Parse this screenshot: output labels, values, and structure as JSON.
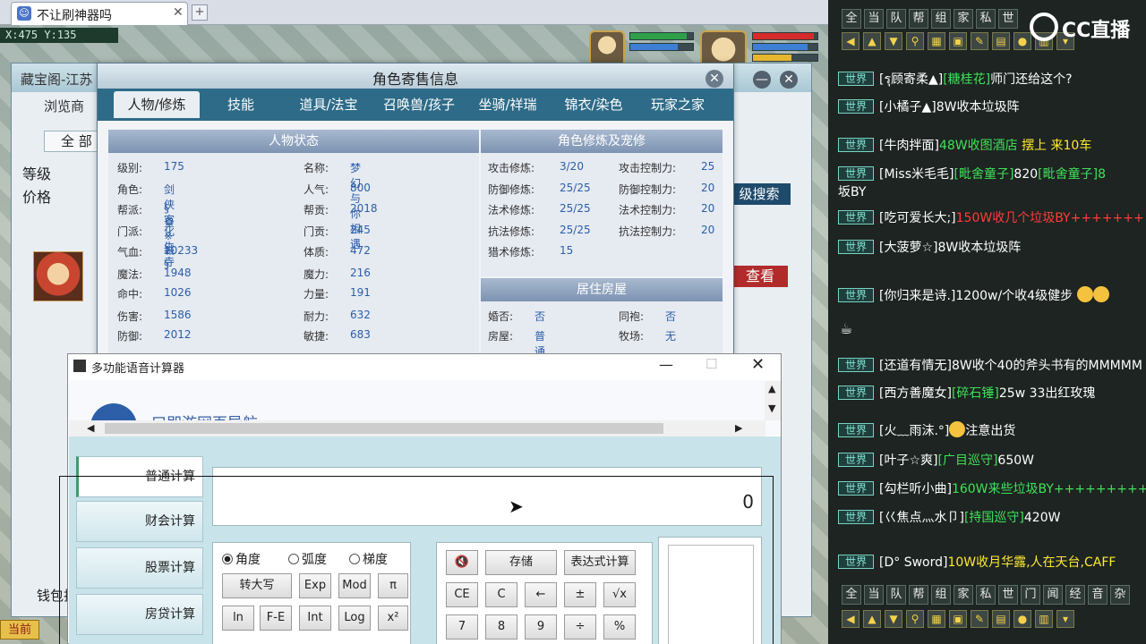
{
  "browser": {
    "tab_title": "不让刷神器吗",
    "tab_close": "✕",
    "tab_add": "+"
  },
  "game": {
    "coords": "X:475 Y:135",
    "bottom_badge": "当前"
  },
  "treasure": {
    "title": "藏宝阁-江苏",
    "browse": "浏览商",
    "all": "全 部",
    "level_label": "等级",
    "price_label": "价格",
    "adv_search": "级搜索",
    "view": "查看",
    "wallet": "钱包抄"
  },
  "role": {
    "title": "角色寄售信息",
    "tabs": [
      "人物/修炼",
      "技能",
      "道具/法宝",
      "召唤兽/孩子",
      "坐骑/祥瑞",
      "锦衣/染色",
      "玩家之家"
    ],
    "status_head": "人物状态",
    "cultivation_head": "角色修炼及宠修",
    "house_head": "居住房屋",
    "left_col": [
      {
        "k": "级别:",
        "v": "175"
      },
      {
        "k": "角色:",
        "v": "剑侠客"
      },
      {
        "k": "帮派:",
        "v": "§皇※城§"
      },
      {
        "k": "门派:",
        "v": "化生寺"
      },
      {
        "k": "气血:",
        "v": "10233"
      },
      {
        "k": "魔法:",
        "v": "1948"
      },
      {
        "k": "命中:",
        "v": "1026"
      },
      {
        "k": "伤害:",
        "v": "1586"
      },
      {
        "k": "防御:",
        "v": "2012"
      }
    ],
    "mid_col": [
      {
        "k": "名称:",
        "v": "梦幻与你相遇"
      },
      {
        "k": "人气:",
        "v": "800"
      },
      {
        "k": "帮贡:",
        "v": "2018"
      },
      {
        "k": "门贡:",
        "v": "245"
      },
      {
        "k": "体质:",
        "v": "472"
      },
      {
        "k": "魔力:",
        "v": "216"
      },
      {
        "k": "力量:",
        "v": "191"
      },
      {
        "k": "耐力:",
        "v": "632"
      },
      {
        "k": "敏捷:",
        "v": "683"
      }
    ],
    "cult_left": [
      {
        "k": "攻击修炼:",
        "v": "3/20"
      },
      {
        "k": "防御修炼:",
        "v": "25/25"
      },
      {
        "k": "法术修炼:",
        "v": "25/25"
      },
      {
        "k": "抗法修炼:",
        "v": "25/25"
      },
      {
        "k": "猎术修炼:",
        "v": "15"
      }
    ],
    "cult_right": [
      {
        "k": "攻击控制力:",
        "v": "25"
      },
      {
        "k": "防御控制力:",
        "v": "20"
      },
      {
        "k": "法术控制力:",
        "v": "20"
      },
      {
        "k": "抗法控制力:",
        "v": "20"
      }
    ],
    "house_left": [
      {
        "k": "婚否:",
        "v": "否"
      },
      {
        "k": "房屋:",
        "v": "普通"
      }
    ],
    "house_right": [
      {
        "k": "同袍:",
        "v": "否"
      },
      {
        "k": "牧场:",
        "v": "无"
      }
    ]
  },
  "calc": {
    "title": "多功能语音计算器",
    "minimize": "—",
    "maximize": "☐",
    "close": "✕",
    "web_text": "口即游网页导航",
    "side": [
      "普通计算",
      "财会计算",
      "股票计算",
      "房贷计算"
    ],
    "display_value": "0",
    "modes": [
      "角度",
      "弧度",
      "梯度"
    ],
    "mode_buttons": [
      "转大写",
      "Exp",
      "Mod",
      "π",
      "ln",
      "F-E",
      "Int",
      "Log",
      "x²"
    ],
    "op_row1": [
      "🔇",
      "存储",
      "表达式计算"
    ],
    "op_row2": [
      "CE",
      "C",
      "←",
      "±",
      "√x"
    ],
    "op_row3": [
      "7",
      "8",
      "9",
      "÷",
      "%"
    ]
  },
  "chat": {
    "logo": "CC直播",
    "channels": [
      "全",
      "当",
      "队",
      "帮",
      "组",
      "家",
      "私",
      "世",
      "门",
      "闻",
      "经",
      "音",
      "杂"
    ],
    "tag": "世界",
    "messages": [
      {
        "name": "[รุ顾寄柔▲]",
        "hl": "[糖桂花]",
        "text": "师门还给这个?",
        "extra": ""
      },
      {
        "name": "[小橘子▲]",
        "hl": "",
        "text": "8W收本垃圾阵",
        "extra": ""
      },
      {
        "name": "[牛肉拌面]",
        "hl": "48W收图酒店",
        "text": "",
        "extra": "摆上  来10车"
      },
      {
        "name": "[Miss米毛毛]",
        "hl": "[毗舍童子]",
        "text": "820",
        "extra": "[毗舍童子]8"
      },
      {
        "name": "",
        "hl": "",
        "text": "坂BY",
        "extra": ""
      },
      {
        "name": "[吃可爱长大;]",
        "hl": "",
        "text": "",
        "extra": "150W收几个垃圾BY+++++++"
      },
      {
        "name": "[大菠萝☆]",
        "hl": "",
        "text": "8W收本垃圾阵",
        "extra": ""
      },
      {
        "name": "[你归来是诗.]",
        "hl": "",
        "text": "1200w/个收4级健步",
        "extra": ""
      },
      {
        "name": "[还道有情无]",
        "hl": "",
        "text": "8W收个40的斧头书有的MMMMM",
        "extra": ""
      },
      {
        "name": "[西方善魔女]",
        "hl": "[碎石锤]",
        "text": "25w  33出红玫瑰",
        "extra": ""
      },
      {
        "name": "[火﹏雨沫.°]",
        "hl": "",
        "text": "注意出货",
        "extra": ""
      },
      {
        "name": "[叶子☆爽]",
        "hl": "[广目巡守]",
        "text": "650W",
        "extra": ""
      },
      {
        "name": "[勾栏听小曲]",
        "hl": "160W来些垃圾BY++++++++++++",
        "text": "",
        "extra": ""
      },
      {
        "name": "[巜焦点灬水卩]",
        "hl": "[持国巡守]",
        "text": "420W",
        "extra": ""
      },
      {
        "name": "[D° Sword]",
        "hl": "",
        "text": "10W收月华露,人在天台,CAFF",
        "extra": ""
      }
    ]
  }
}
